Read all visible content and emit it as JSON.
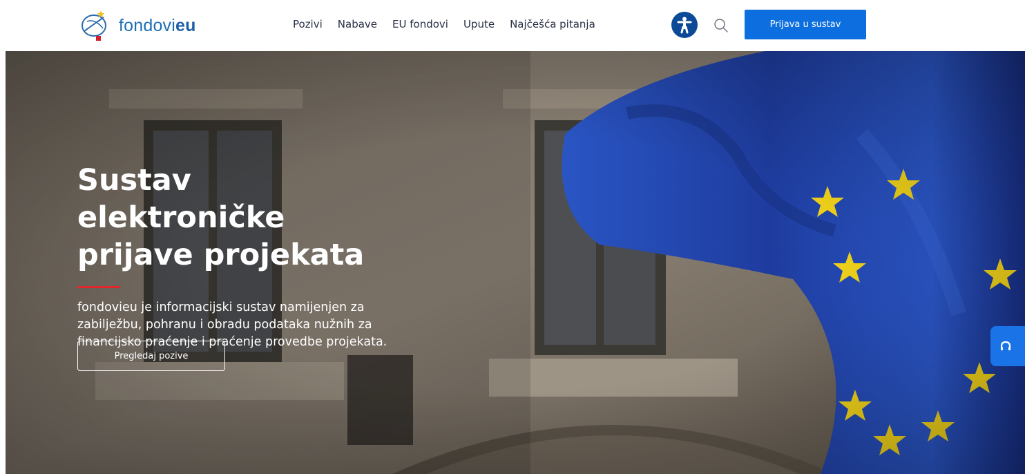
{
  "header": {
    "logo": {
      "text_regular": "fondovi",
      "text_bold": "eu"
    },
    "nav": [
      {
        "label": "Pozivi"
      },
      {
        "label": "Nabave"
      },
      {
        "label": "EU fondovi"
      },
      {
        "label": "Upute"
      },
      {
        "label": "Najčešća pitanja"
      }
    ],
    "accessibility_icon": "accessibility-person-icon",
    "search_icon": "search-icon",
    "login_label": "Prijava u sustav"
  },
  "hero": {
    "title": "Sustav elektroničke prijave projekata",
    "description": "fondovieu je informacijski sustav namijenjen za zabilježbu, pohranu i obradu podataka nužnih za financijsko praćenje i praćenje provedbe projekata.",
    "cta_label": "Pregledaj pozive",
    "background": "building-facade-with-eu-flag"
  },
  "support": {
    "icon": "headset-icon"
  },
  "colors": {
    "primary": "#0d6fdf",
    "logo_blue": "#1d6fb5",
    "accent_red": "#e0272d",
    "accessibility_bg": "#0c4a97",
    "eu_flag_blue": "#1f3fa6",
    "eu_star_yellow": "#f2d21a"
  }
}
